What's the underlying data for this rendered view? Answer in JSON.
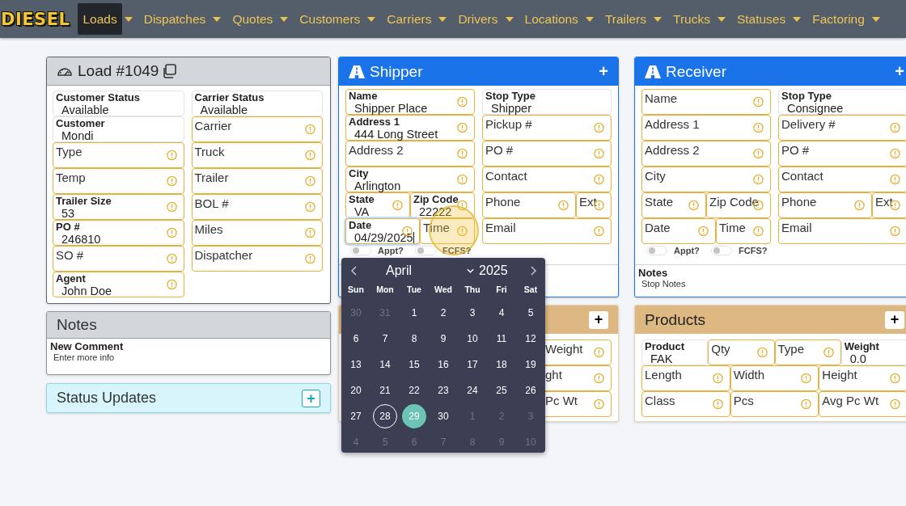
{
  "nav": {
    "logo": "DIESEL",
    "items": [
      {
        "label": "Loads",
        "selected": true
      },
      {
        "label": "Dispatches",
        "selected": false
      },
      {
        "label": "Quotes",
        "selected": false
      },
      {
        "label": "Customers",
        "selected": false
      },
      {
        "label": "Carriers",
        "selected": false
      },
      {
        "label": "Drivers",
        "selected": false
      },
      {
        "label": "Locations",
        "selected": false
      },
      {
        "label": "Trailers",
        "selected": false
      },
      {
        "label": "Trucks",
        "selected": false
      },
      {
        "label": "Statuses",
        "selected": false
      },
      {
        "label": "Factoring",
        "selected": false
      }
    ]
  },
  "load": {
    "title": "Load #1049",
    "left": [
      {
        "label": "Customer Status",
        "value": "Available",
        "warn": false
      },
      {
        "label": "Customer",
        "value": "Mondi",
        "warn": false
      },
      {
        "label": "Type",
        "warn": true
      },
      {
        "label": "Temp",
        "warn": true
      },
      {
        "label": "Trailer Size",
        "value": "53",
        "warn": true
      },
      {
        "label": "PO #",
        "value": "246810",
        "warn": true
      },
      {
        "label": "SO #",
        "warn": true
      },
      {
        "label": "Agent",
        "value": "John Doe",
        "warn": true
      }
    ],
    "right": [
      {
        "label": "Carrier Status",
        "value": "Available",
        "warn": false
      },
      {
        "label": "Carrier",
        "warn": true
      },
      {
        "label": "Truck",
        "warn": true
      },
      {
        "label": "Trailer",
        "warn": true
      },
      {
        "label": "BOL #",
        "warn": true
      },
      {
        "label": "Miles",
        "warn": true
      },
      {
        "label": "Dispatcher",
        "warn": true
      }
    ]
  },
  "notes": {
    "title": "Notes",
    "label": "New Comment",
    "placeholder": "Enter more info"
  },
  "status_updates": {
    "title": "Status Updates",
    "button": "+"
  },
  "shipper": {
    "title": "Shipper",
    "button": "+",
    "left": [
      [
        {
          "label": "Name",
          "value": "Shipper Place",
          "warn": true
        }
      ],
      [
        {
          "label": "Address 1",
          "value": "444 Long Street",
          "warn": true
        }
      ],
      [
        {
          "label": "Address 2",
          "warn": true
        }
      ],
      [
        {
          "label": "City",
          "value": "Arlington",
          "warn": true
        }
      ],
      [
        {
          "label": "State",
          "value": "VA",
          "warn": true
        },
        {
          "label": "Zip Code",
          "value": "22222",
          "warn": true
        }
      ],
      [
        {
          "label": "Date",
          "value": "04/29/2025",
          "warn": true,
          "focused": true
        },
        {
          "label": "Time",
          "warn": true,
          "pointer": true
        }
      ]
    ],
    "right": [
      [
        {
          "label": "Stop Type",
          "value": "Shipper",
          "warn": false
        }
      ],
      [
        {
          "label": "Pickup #",
          "warn": true
        }
      ],
      [
        {
          "label": "PO #",
          "warn": true
        }
      ],
      [
        {
          "label": "Contact",
          "warn": true
        }
      ],
      [
        {
          "label": "Phone",
          "warn": true
        },
        {
          "label": "Ext",
          "warn": true
        }
      ],
      [
        {
          "label": "Email",
          "warn": true
        }
      ]
    ],
    "toggles": [
      {
        "label": "Appt?",
        "on": false
      },
      {
        "label": "FCFS?",
        "on": false
      }
    ]
  },
  "calendar": {
    "month": "April",
    "year": "2025",
    "weekdays": [
      "Sun",
      "Mon",
      "Tue",
      "Wed",
      "Thu",
      "Fri",
      "Sat"
    ],
    "days": [
      {
        "label": "30",
        "muted": true,
        "today": false,
        "selected": false
      },
      {
        "label": "31",
        "muted": true,
        "today": false,
        "selected": false
      },
      {
        "label": "1",
        "muted": false,
        "today": false,
        "selected": false
      },
      {
        "label": "2",
        "muted": false,
        "today": false,
        "selected": false
      },
      {
        "label": "3",
        "muted": false,
        "today": false,
        "selected": false
      },
      {
        "label": "4",
        "muted": false,
        "today": false,
        "selected": false
      },
      {
        "label": "5",
        "muted": false,
        "today": false,
        "selected": false
      },
      {
        "label": "6",
        "muted": false,
        "today": false,
        "selected": false
      },
      {
        "label": "7",
        "muted": false,
        "today": false,
        "selected": false
      },
      {
        "label": "8",
        "muted": false,
        "today": false,
        "selected": false
      },
      {
        "label": "9",
        "muted": false,
        "today": false,
        "selected": false
      },
      {
        "label": "10",
        "muted": false,
        "today": false,
        "selected": false
      },
      {
        "label": "11",
        "muted": false,
        "today": false,
        "selected": false
      },
      {
        "label": "12",
        "muted": false,
        "today": false,
        "selected": false
      },
      {
        "label": "13",
        "muted": false,
        "today": false,
        "selected": false
      },
      {
        "label": "14",
        "muted": false,
        "today": false,
        "selected": false
      },
      {
        "label": "15",
        "muted": false,
        "today": false,
        "selected": false
      },
      {
        "label": "16",
        "muted": false,
        "today": false,
        "selected": false
      },
      {
        "label": "17",
        "muted": false,
        "today": false,
        "selected": false
      },
      {
        "label": "18",
        "muted": false,
        "today": false,
        "selected": false
      },
      {
        "label": "19",
        "muted": false,
        "today": false,
        "selected": false
      },
      {
        "label": "20",
        "muted": false,
        "today": false,
        "selected": false
      },
      {
        "label": "21",
        "muted": false,
        "today": false,
        "selected": false
      },
      {
        "label": "22",
        "muted": false,
        "today": false,
        "selected": false
      },
      {
        "label": "23",
        "muted": false,
        "today": false,
        "selected": false
      },
      {
        "label": "24",
        "muted": false,
        "today": false,
        "selected": false
      },
      {
        "label": "25",
        "muted": false,
        "today": false,
        "selected": false
      },
      {
        "label": "26",
        "muted": false,
        "today": false,
        "selected": false
      },
      {
        "label": "27",
        "muted": false,
        "today": false,
        "selected": false
      },
      {
        "label": "28",
        "muted": false,
        "today": true,
        "selected": false
      },
      {
        "label": "29",
        "muted": false,
        "today": false,
        "selected": true
      },
      {
        "label": "30",
        "muted": false,
        "today": false,
        "selected": false
      },
      {
        "label": "1",
        "muted": true,
        "today": false,
        "selected": false
      },
      {
        "label": "2",
        "muted": true,
        "today": false,
        "selected": false
      },
      {
        "label": "3",
        "muted": true,
        "today": false,
        "selected": false
      },
      {
        "label": "4",
        "muted": true,
        "today": false,
        "selected": false
      },
      {
        "label": "5",
        "muted": true,
        "today": false,
        "selected": false
      },
      {
        "label": "6",
        "muted": true,
        "today": false,
        "selected": false
      },
      {
        "label": "7",
        "muted": true,
        "today": false,
        "selected": false
      },
      {
        "label": "8",
        "muted": true,
        "today": false,
        "selected": false
      },
      {
        "label": "9",
        "muted": true,
        "today": false,
        "selected": false
      },
      {
        "label": "10",
        "muted": true,
        "today": false,
        "selected": false
      }
    ]
  },
  "shipper_products": {
    "button": "+",
    "cells": [
      {
        "label": "Weight",
        "warn": true
      },
      {
        "label": "ght",
        "warn": true
      },
      {
        "label": "Pc Wt",
        "warn": true
      }
    ]
  },
  "receiver": {
    "title": "Receiver",
    "button": "+",
    "left": [
      [
        {
          "label": "Name",
          "warn": true
        }
      ],
      [
        {
          "label": "Address 1",
          "warn": true
        }
      ],
      [
        {
          "label": "Address 2",
          "warn": true
        }
      ],
      [
        {
          "label": "City",
          "warn": true
        }
      ],
      [
        {
          "label": "State",
          "warn": true
        },
        {
          "label": "Zip Code",
          "warn": true
        }
      ],
      [
        {
          "label": "Date",
          "warn": true
        },
        {
          "label": "Time",
          "warn": true
        }
      ]
    ],
    "right": [
      [
        {
          "label": "Stop Type",
          "value": "Consignee",
          "warn": false
        }
      ],
      [
        {
          "label": "Delivery #",
          "warn": true
        }
      ],
      [
        {
          "label": "PO #",
          "warn": true
        }
      ],
      [
        {
          "label": "Contact",
          "warn": true
        }
      ],
      [
        {
          "label": "Phone",
          "warn": true
        },
        {
          "label": "Ext",
          "warn": true
        }
      ],
      [
        {
          "label": "Email",
          "warn": true
        }
      ]
    ],
    "toggles": [
      {
        "label": "Appt?",
        "on": false
      },
      {
        "label": "FCFS?",
        "on": false
      }
    ],
    "notes": {
      "label": "Notes",
      "value": "Stop Notes"
    }
  },
  "products": {
    "title": "Products",
    "button": "+",
    "rows": [
      [
        {
          "label": "Product",
          "value": "FAK",
          "warn": false
        },
        {
          "label": "Qty",
          "warn": true
        },
        {
          "label": "Type",
          "warn": true
        },
        {
          "label": "Weight",
          "value": "0.0",
          "warn": false
        }
      ],
      [
        {
          "label": "Length",
          "warn": true
        },
        {
          "label": "Width",
          "warn": true
        },
        {
          "label": "Height",
          "warn": true
        }
      ],
      [
        {
          "label": "Class",
          "warn": true
        },
        {
          "label": "Pcs",
          "warn": true
        },
        {
          "label": "Avg Pc Wt",
          "warn": true
        }
      ]
    ]
  }
}
